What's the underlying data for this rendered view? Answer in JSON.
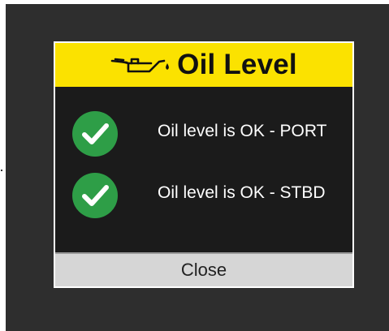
{
  "dialog": {
    "title": "Oil Level",
    "header_icon": "oil-can-icon",
    "header_color": "#fbe200",
    "rows": [
      {
        "icon": "check-circle-icon",
        "text": "Oil level is OK - PORT"
      },
      {
        "icon": "check-circle-icon",
        "text": "Oil level is OK - STBD"
      }
    ],
    "status_color": "#2e9e47",
    "close_label": "Close"
  }
}
